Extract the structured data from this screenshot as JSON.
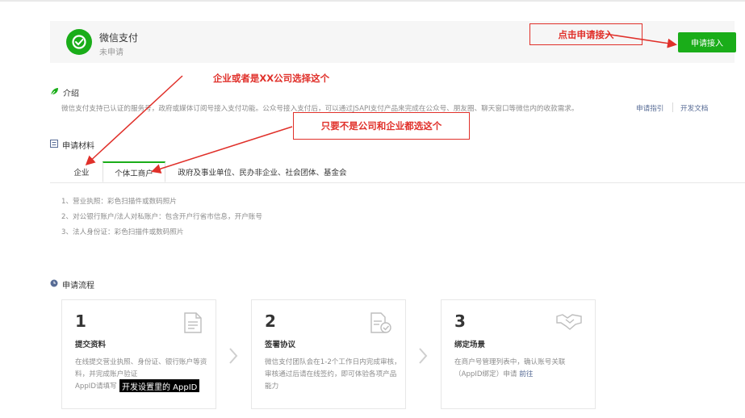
{
  "header": {
    "app_name": "微信支付",
    "status": "未申请",
    "apply_button": "申请接入"
  },
  "intro": {
    "title": "介绍",
    "text": "微信支付支持已认证的服务号，政府或媒体订阅号接入支付功能。公众号接入支付后，可以通过JSAPI支付产品来完成在公众号、朋友圈、聊天窗口等微信内的收款需求。",
    "link_guide": "申请指引",
    "link_docs": "开发文档"
  },
  "materials": {
    "title": "申请材料",
    "tabs": [
      "企业",
      "个体工商户",
      "政府及事业单位、民办非企业、社会团体、基金会"
    ],
    "active_tab": "个体工商户",
    "items": [
      "1、营业执照：彩色扫描件或数码照片",
      "2、对公银行账户/法人对私账户：包含开户行省市信息，开户账号",
      "3、法人身份证：彩色扫描件或数码照片"
    ]
  },
  "process": {
    "title": "申请流程",
    "steps": [
      {
        "num": "1",
        "title": "提交资料",
        "desc": "在线提交营业执照、身份证、银行账户等资料，并完成账户验证",
        "extra": "AppID请填写",
        "icon": "document-icon"
      },
      {
        "num": "2",
        "title": "签署协议",
        "desc": "微信支付团队会在1-2个工作日内完成审核，审核通过后请在线签约，即可体验各项产品能力",
        "icon": "contract-check-icon"
      },
      {
        "num": "3",
        "title": "绑定场景",
        "desc": "在商户号管理列表中，确认账号关联（AppID绑定）申请",
        "link": "前往",
        "icon": "handshake-icon"
      }
    ]
  },
  "annotations": {
    "click_apply": "点击申请接入",
    "enterprise_note": "企业或者是XX公司选择这个",
    "individual_note": "只要不是公司和企业都选这个",
    "redact_label": "开发设置里的 AppID"
  },
  "colors": {
    "accent_green": "#1aad19",
    "annotation_red": "#e0302a",
    "link_blue": "#576b95"
  }
}
